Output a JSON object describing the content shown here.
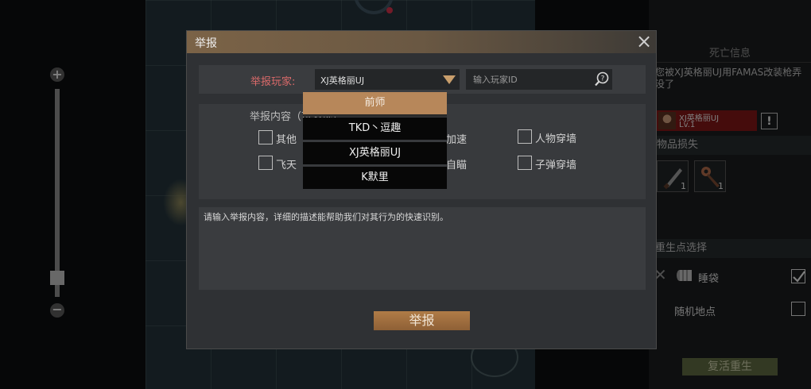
{
  "zoom": {
    "plus": "+",
    "minus": "−",
    "level": 0.06
  },
  "right_panel": {
    "death_title": "死亡信息",
    "death_message": "您被XJ英格丽UJ用FAMAS改装枪弄没了",
    "killer_name": "XJ英格丽UJ",
    "killer_level": "Lv.1",
    "report_icon": "!",
    "lost_items_header": "物品损失",
    "lost_items": [
      {
        "icon": "knife-icon",
        "count": "1"
      },
      {
        "icon": "wrench-icon",
        "count": "1"
      }
    ],
    "respawn_header": "重生点选择",
    "respawn_options": [
      {
        "label": "睡袋",
        "icon": "bedroll-icon",
        "checked": true
      },
      {
        "label": "随机地点",
        "checked": false
      }
    ],
    "revive_button": "复活重生"
  },
  "dialog": {
    "title": "举报",
    "close": "×",
    "player_label": "举报玩家:",
    "selected_player": "XJ英格丽UJ",
    "player_id_placeholder": "输入玩家ID",
    "content_label": "举报内容（可多选）",
    "options": [
      {
        "label": "其他",
        "checked": false
      },
      {
        "label": "加速",
        "checked": false
      },
      {
        "label": "人物穿墙",
        "checked": false
      },
      {
        "label": "飞天",
        "checked": false
      },
      {
        "label": "自瞄",
        "checked": false
      },
      {
        "label": "子弹穿墙",
        "checked": false
      }
    ],
    "description_placeholder": "请输入举报内容，详细的描述能帮助我们对其行为的快速识别。",
    "submit": "举报"
  },
  "dropdown": {
    "items": [
      "前师",
      "TKD丶逗趣",
      "XJ英格丽UJ",
      "K默里"
    ],
    "highlighted_index": 0
  },
  "colors": {
    "accent": "#b7875a",
    "player_label": "#d96a6a",
    "killer_card": "#7e1616",
    "revive_button": "#5e6840"
  }
}
